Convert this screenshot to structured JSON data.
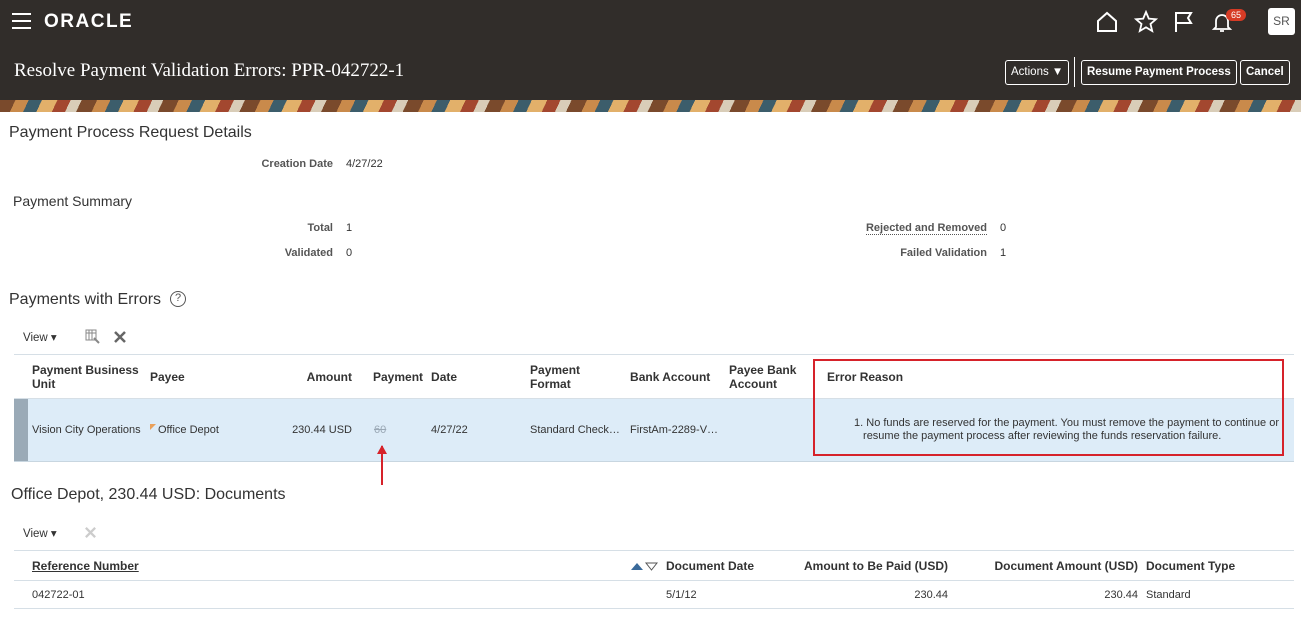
{
  "header": {
    "brand": "ORACLE",
    "notifications_count": "65",
    "user_initials": "SR",
    "page_title": "Resolve Payment Validation Errors: PPR-042722-1",
    "actions_label": "Actions ▼",
    "resume_label": "Resume Payment Process",
    "cancel_label": "Cancel"
  },
  "details": {
    "heading": "Payment Process Request Details",
    "creation_date_label": "Creation Date",
    "creation_date_value": "4/27/22"
  },
  "summary": {
    "heading": "Payment Summary",
    "total_label": "Total",
    "total_value": "1",
    "validated_label": "Validated",
    "validated_value": "0",
    "rejected_label": "Rejected and Removed",
    "rejected_value": "0",
    "failed_label": "Failed Validation",
    "failed_value": "1"
  },
  "errors_section": {
    "heading": "Payments with Errors",
    "view_label": "View ▾",
    "columns": [
      "Payment Business Unit",
      "Payee",
      "Amount",
      "Payment",
      "Date",
      "Payment Format",
      "Bank Account",
      "Payee Bank Account",
      "Error Reason"
    ],
    "row": {
      "business_unit": "Vision City Operations",
      "payee": "Office Depot",
      "amount": "230.44 USD",
      "payment": "60",
      "date": "4/27/22",
      "payment_format": "Standard Check…",
      "bank_account": "FirstAm-2289-V…",
      "payee_bank_account": "",
      "error_reason_line1": "1. No funds are reserved for the payment. You must remove the payment to continue or",
      "error_reason_line2": "resume the payment process after reviewing the funds reservation failure."
    }
  },
  "documents_section": {
    "heading": "Office Depot, 230.44 USD: Documents",
    "view_label": "View ▾",
    "columns": [
      "Reference Number",
      "Document Date",
      "Amount to Be Paid (USD)",
      "Document Amount (USD)",
      "Document Type"
    ],
    "row": {
      "reference_number": "042722-01",
      "document_date": "5/1/12",
      "amount_to_be_paid": "230.44",
      "document_amount": "230.44",
      "document_type": "Standard"
    }
  }
}
